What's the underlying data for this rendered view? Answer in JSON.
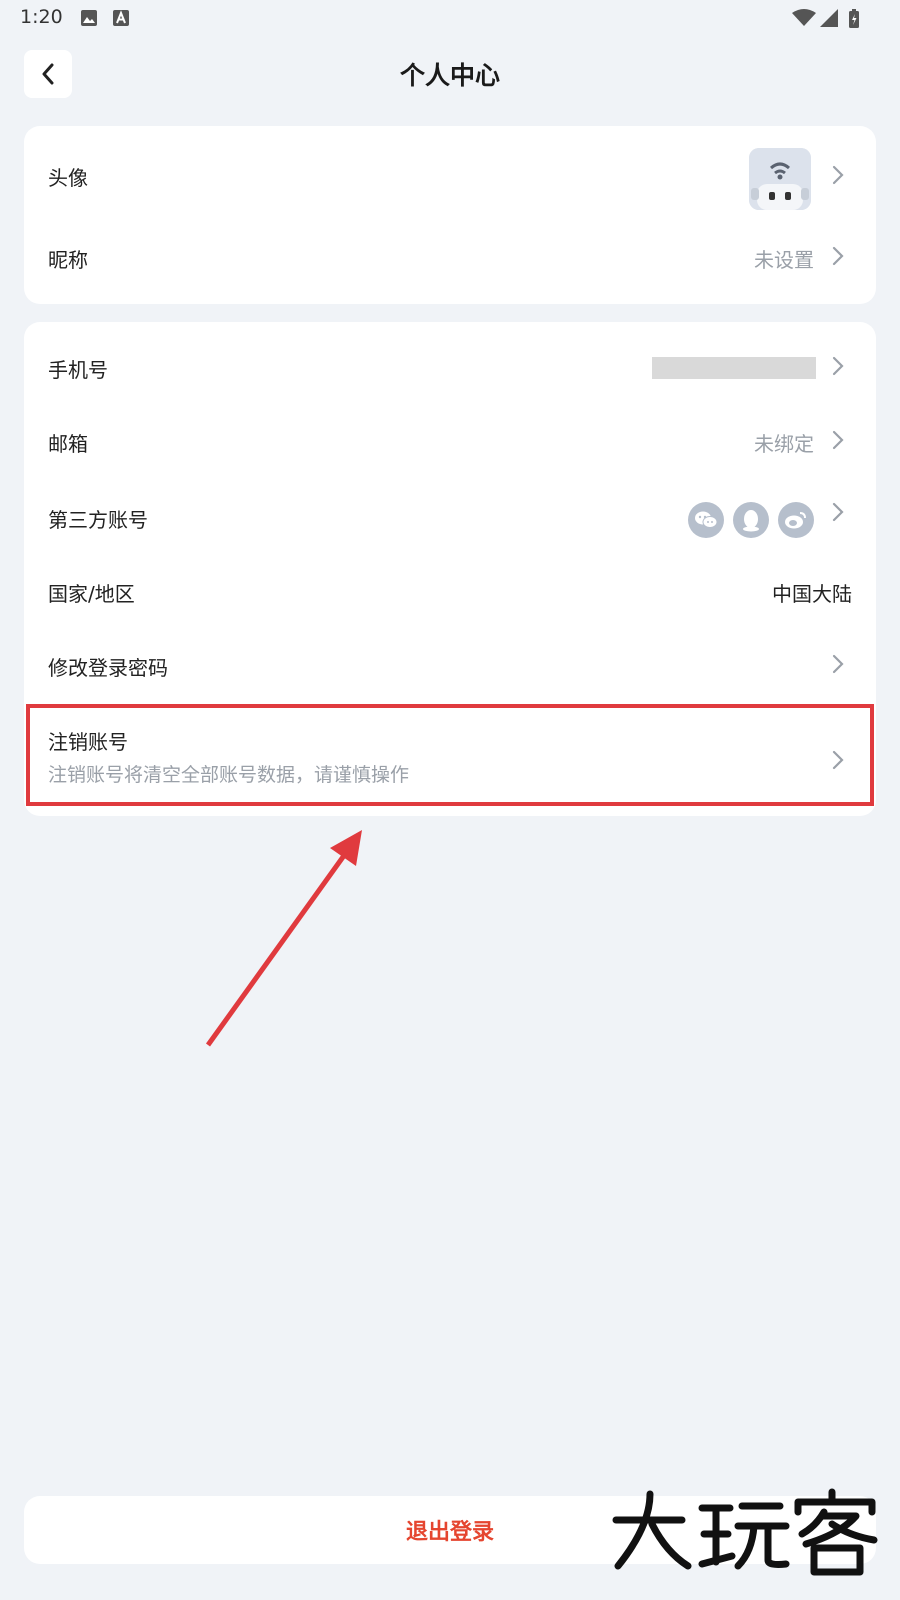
{
  "status_bar": {
    "time": "1:20"
  },
  "header": {
    "title": "个人中心"
  },
  "profile_card": {
    "avatar_label": "头像",
    "nickname_label": "昵称",
    "nickname_value": "未设置"
  },
  "account_card": {
    "phone_label": "手机号",
    "email_label": "邮箱",
    "email_value": "未绑定",
    "third_party_label": "第三方账号",
    "third_party_icons": [
      "wechat-icon",
      "qq-icon",
      "weibo-icon"
    ],
    "region_label": "国家/地区",
    "region_value": "中国大陆",
    "password_label": "修改登录密码",
    "cancel_label": "注销账号",
    "cancel_desc": "注销账号将清空全部账号数据，请谨慎操作"
  },
  "logout": {
    "label": "退出登录"
  },
  "watermark": {
    "text": "大玩客"
  },
  "colors": {
    "background": "#f0f3f7",
    "card": "#ffffff",
    "muted_text": "#9aa0a8",
    "logout_red": "#e5452f",
    "annotation_red": "#e03a3e"
  }
}
